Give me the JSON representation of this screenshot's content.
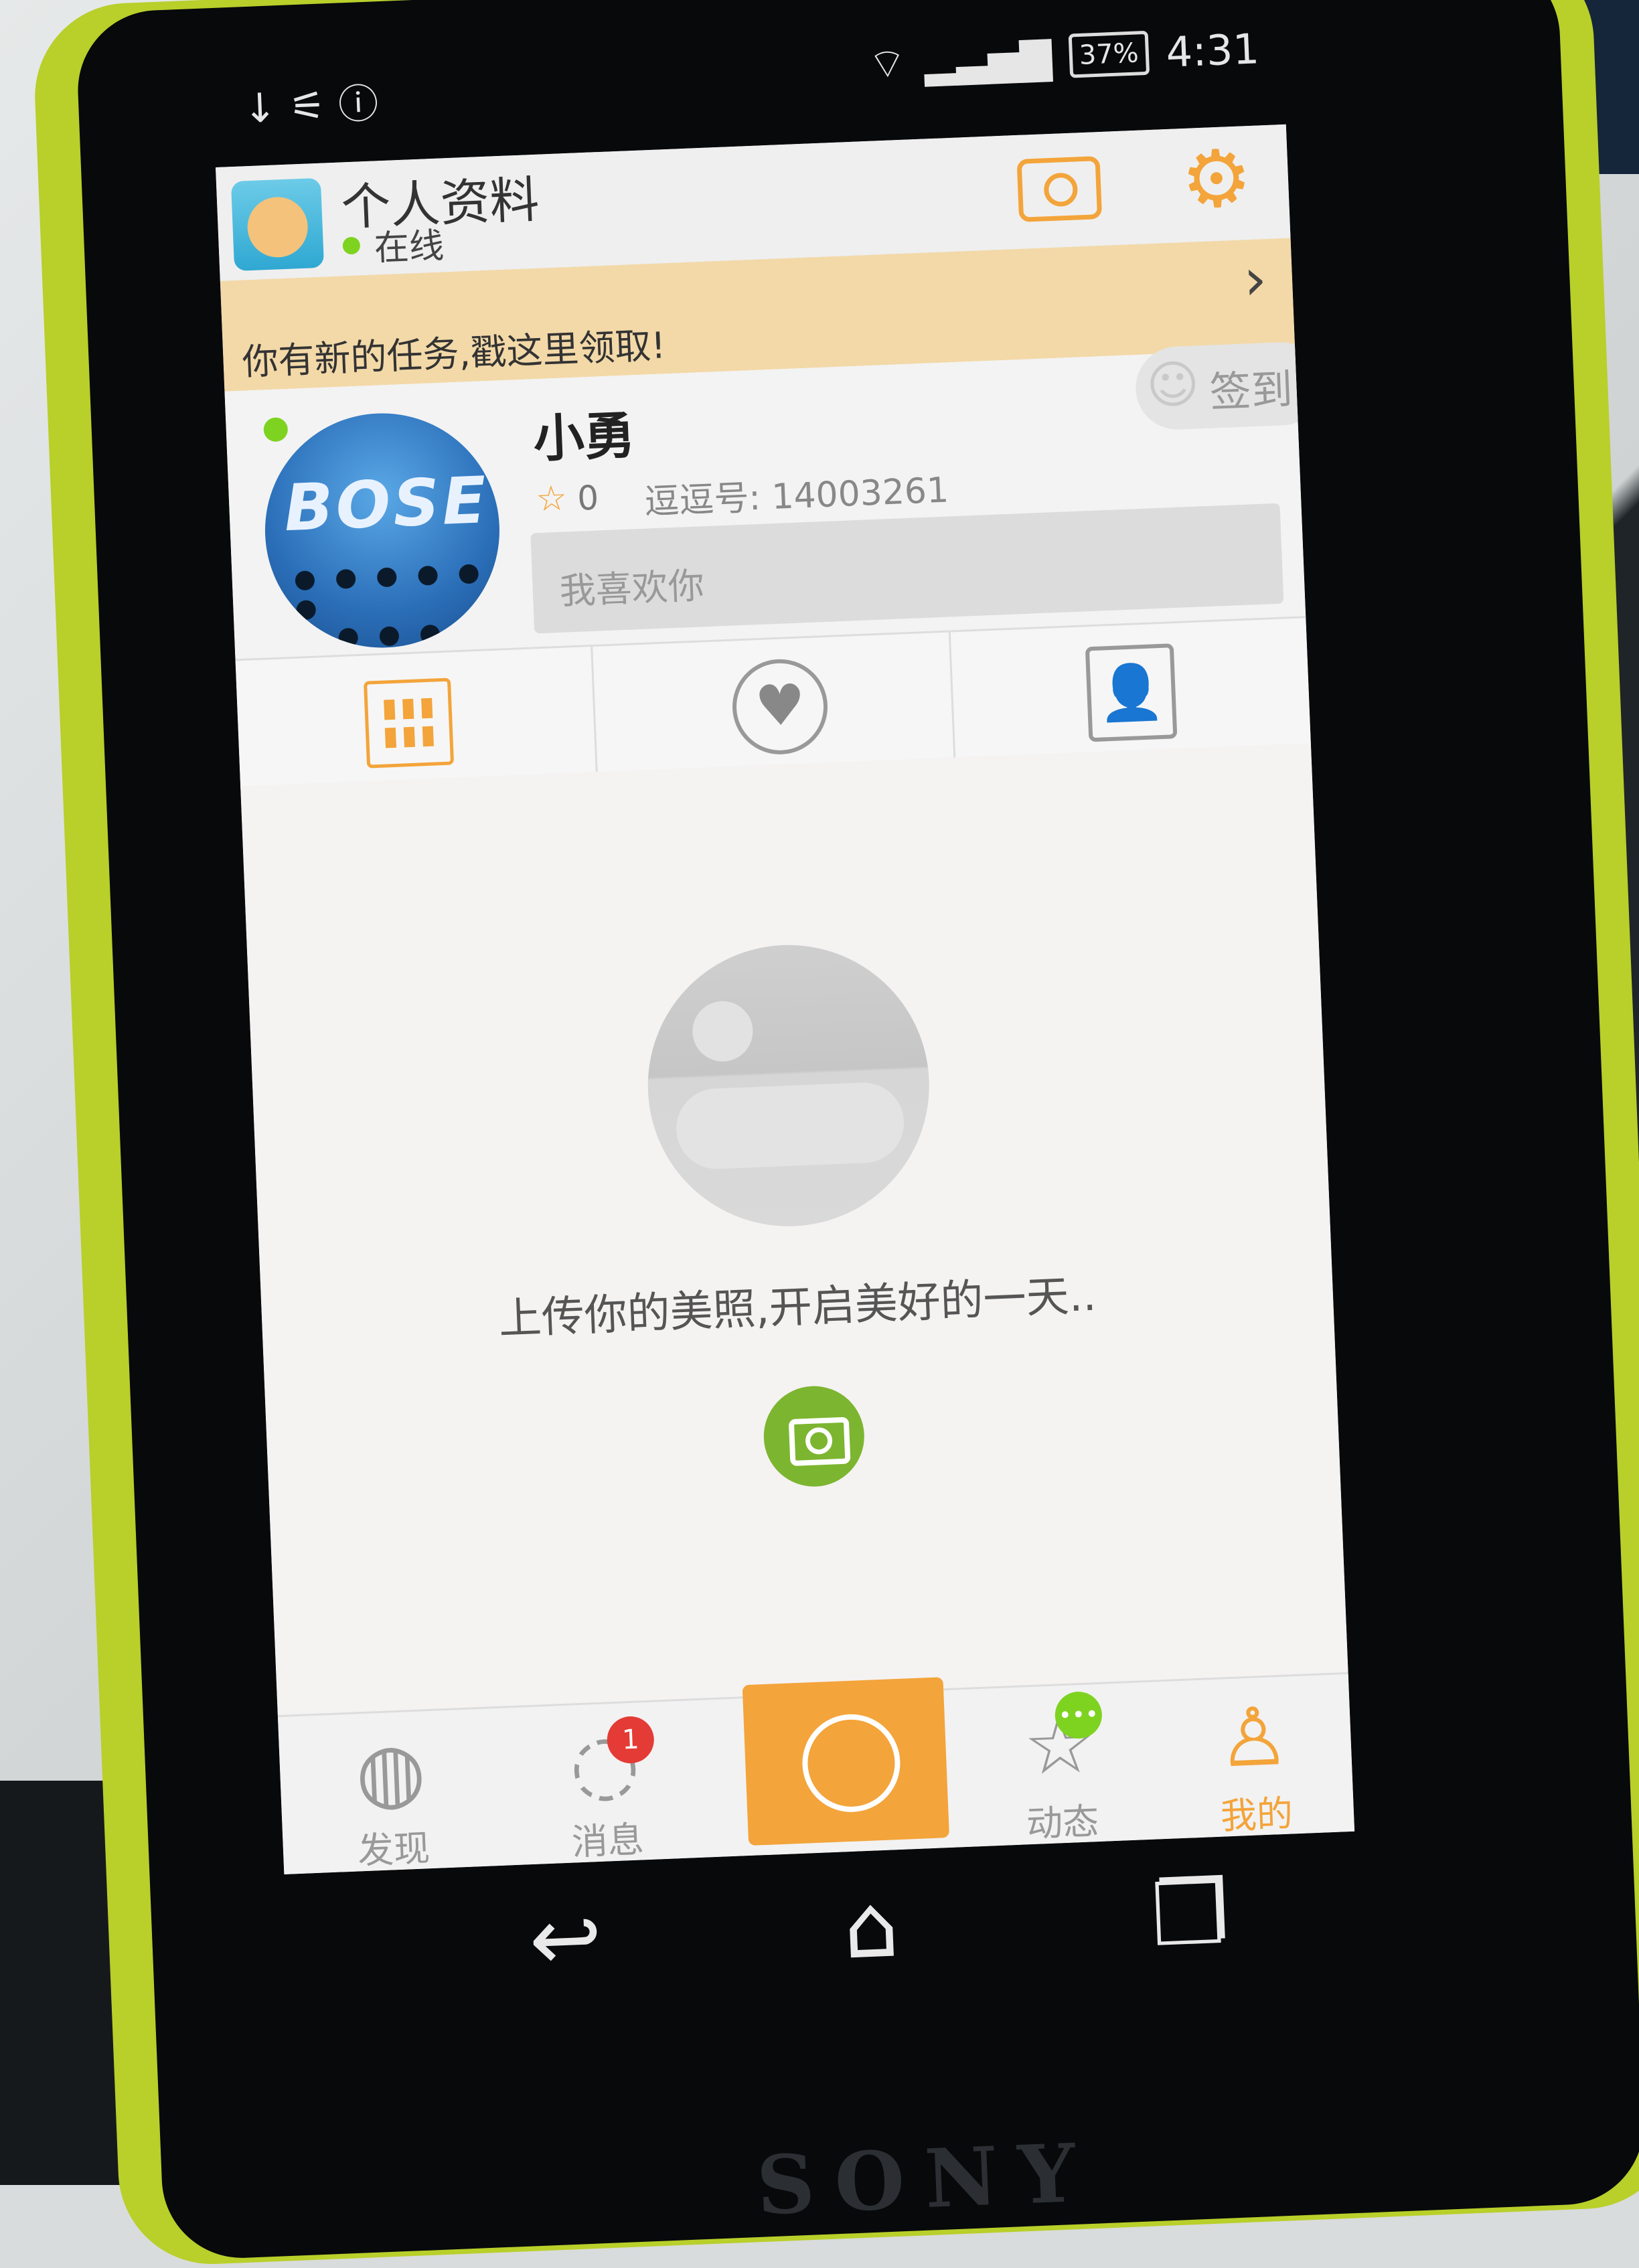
{
  "statusbar": {
    "left_icons": "↓ ⚟ ⓘ",
    "wifi": "⌔",
    "signal": "▂▃▅▇",
    "battery": "37%",
    "time": "4:31"
  },
  "header": {
    "title": "个人资料",
    "status": "在线"
  },
  "task_banner": {
    "text": "你有新的任务,戳这里领取!",
    "arrow": "›"
  },
  "profile": {
    "avatar_text": "BOSE",
    "nickname": "小勇",
    "stars": "0",
    "id_label": "逗逗号: 14003261",
    "checkin": "签到",
    "signature": "我喜欢你"
  },
  "empty_state": {
    "prompt": "上传你的美照,开启美好的一天.."
  },
  "bottom_nav": {
    "items": [
      {
        "label": "发现",
        "icon": "globe-icon"
      },
      {
        "label": "消息",
        "icon": "chat-icon",
        "badge": "1"
      },
      {
        "label": "动态",
        "icon": "star-icon",
        "badge": "•••"
      },
      {
        "label": "我的",
        "icon": "person-icon"
      }
    ]
  },
  "colors": {
    "accent": "#f3a43a",
    "online": "#7ed321",
    "upload": "#7cb52f",
    "badge": "#e43b36",
    "banner": "#f3d9a8"
  },
  "device": {
    "brand": "SONY"
  }
}
